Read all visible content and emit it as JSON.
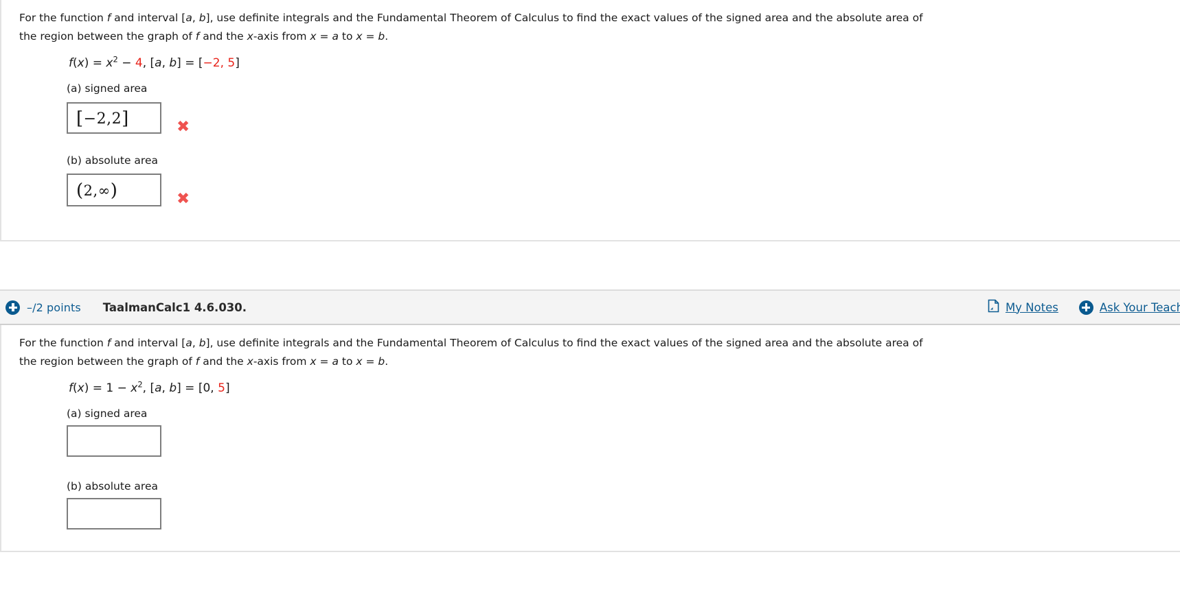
{
  "problems": [
    {
      "prompt_line1_a": "For the function ",
      "prompt_f1": "f",
      "prompt_line1_b": " and interval  [",
      "prompt_a1": "a",
      "prompt_comma1": ", ",
      "prompt_b1": "b",
      "prompt_line1_c": "],  use definite integrals and the Fundamental Theorem of Calculus to find the exact values of the signed area and the absolute area of",
      "prompt_line2_a": "the region between the graph of ",
      "prompt_f2": "f",
      "prompt_line2_b": " and the ",
      "prompt_x1": "x",
      "prompt_line2_c": "-axis from  ",
      "prompt_x2": "x",
      "prompt_line2_d": " = ",
      "prompt_a2": "a",
      "prompt_line2_e": "  to  ",
      "prompt_x3": "x",
      "prompt_line2_f": " = ",
      "prompt_b2": "b",
      "prompt_line2_g": ".",
      "equation": {
        "fx": "f",
        "open_paren": "(",
        "var": "x",
        "close_paren": ")",
        "eq1": " = ",
        "base": "x",
        "exp": "2",
        "minus": " − ",
        "constant": "4",
        "comma": ",  [",
        "ivar_a": "a",
        "icomma": ", ",
        "ivar_b": "b",
        "eq2": "] = [",
        "lower": "−2",
        "mid": ", ",
        "upper": "5",
        "close": "]"
      },
      "parts": [
        {
          "label": "(a) signed area",
          "answer": "[−2,2]",
          "answer_open": "[",
          "answer_inner": "−2,2",
          "answer_close": "]",
          "mark": "✖",
          "mark_name": "incorrect"
        },
        {
          "label": "(b) absolute area",
          "answer": "(2,∞)",
          "answer_open": "(",
          "answer_inner": "2,∞",
          "answer_close": ")",
          "mark": "✖",
          "mark_name": "incorrect"
        }
      ]
    },
    {
      "header": {
        "points": "–/2 points",
        "title": "TaalmanCalc1 4.6.030.",
        "my_notes": "My Notes",
        "ask_teacher": "Ask Your Teacher"
      },
      "prompt_line1_a": "For the function ",
      "prompt_f1": "f",
      "prompt_line1_b": " and interval  [",
      "prompt_a1": "a",
      "prompt_comma1": ", ",
      "prompt_b1": "b",
      "prompt_line1_c": "],  use definite integrals and the Fundamental Theorem of Calculus to find the exact values of the signed area and the absolute area of",
      "prompt_line2_a": "the region between the graph of ",
      "prompt_f2": "f",
      "prompt_line2_b": " and the ",
      "prompt_x1": "x",
      "prompt_line2_c": "-axis from  ",
      "prompt_x2": "x",
      "prompt_line2_d": " = ",
      "prompt_a2": "a",
      "prompt_line2_e": "  to  ",
      "prompt_x3": "x",
      "prompt_line2_f": " = ",
      "prompt_b2": "b",
      "prompt_line2_g": ".",
      "equation": {
        "fx": "f",
        "open_paren": "(",
        "var": "x",
        "close_paren": ")",
        "eq1": " = 1 − ",
        "base": "x",
        "exp": "2",
        "comma": ",  [",
        "ivar_a": "a",
        "icomma": ", ",
        "ivar_b": "b",
        "eq2": "] = [",
        "lower": "0",
        "mid": ", ",
        "upper": "5",
        "close": "]"
      },
      "parts": [
        {
          "label": "(a) signed area",
          "answer": ""
        },
        {
          "label": "(b) absolute area",
          "answer": ""
        }
      ]
    }
  ],
  "colors": {
    "link_blue": "#0d5c91",
    "accent_red": "#e8231a",
    "mark_red": "#ef5350",
    "box_border": "#7d7d7d",
    "header_bg": "#f4f4f4"
  },
  "icons": {
    "plus": "plus-circle-icon",
    "note": "note-icon"
  }
}
